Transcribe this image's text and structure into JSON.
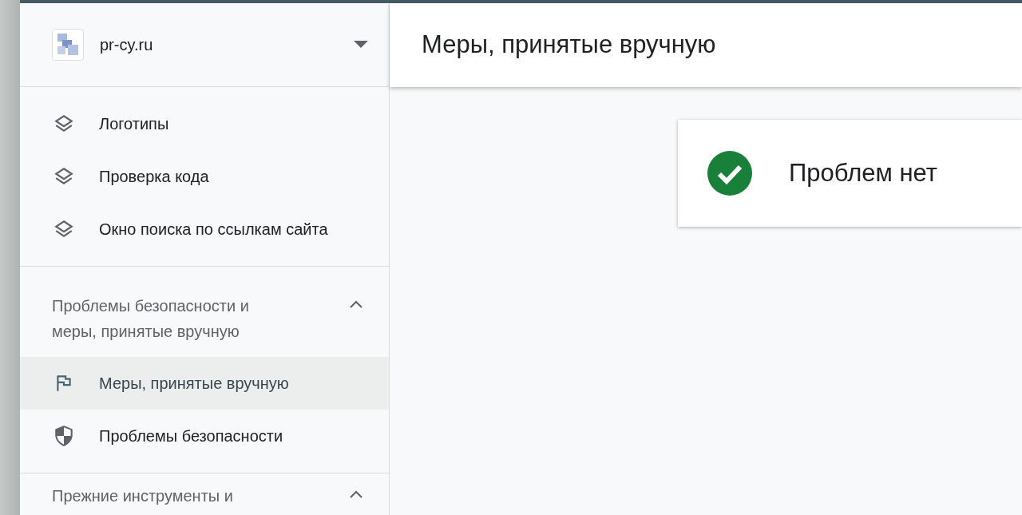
{
  "site_selector": {
    "label": "pr-cy.ru"
  },
  "sidebar": {
    "sections": [
      {
        "items": [
          {
            "label": "Логотипы",
            "kind": "layers",
            "selected": false
          },
          {
            "label": "Проверка кода",
            "kind": "layers",
            "selected": false
          },
          {
            "label": "Окно поиска по ссылкам сайта",
            "kind": "layers",
            "selected": false
          }
        ]
      },
      {
        "title": "Проблемы безопасности и меры, принятые вручную",
        "expanded": true,
        "items": [
          {
            "label": "Меры, принятые вручную",
            "kind": "flag",
            "selected": true
          },
          {
            "label": "Проблемы безопасности",
            "kind": "shield",
            "selected": false
          }
        ]
      },
      {
        "title": "Прежние инструменты и",
        "expanded": true
      }
    ]
  },
  "page": {
    "title": "Меры, принятые вручную",
    "status": {
      "text": "Проблем нет",
      "ok": true
    }
  }
}
